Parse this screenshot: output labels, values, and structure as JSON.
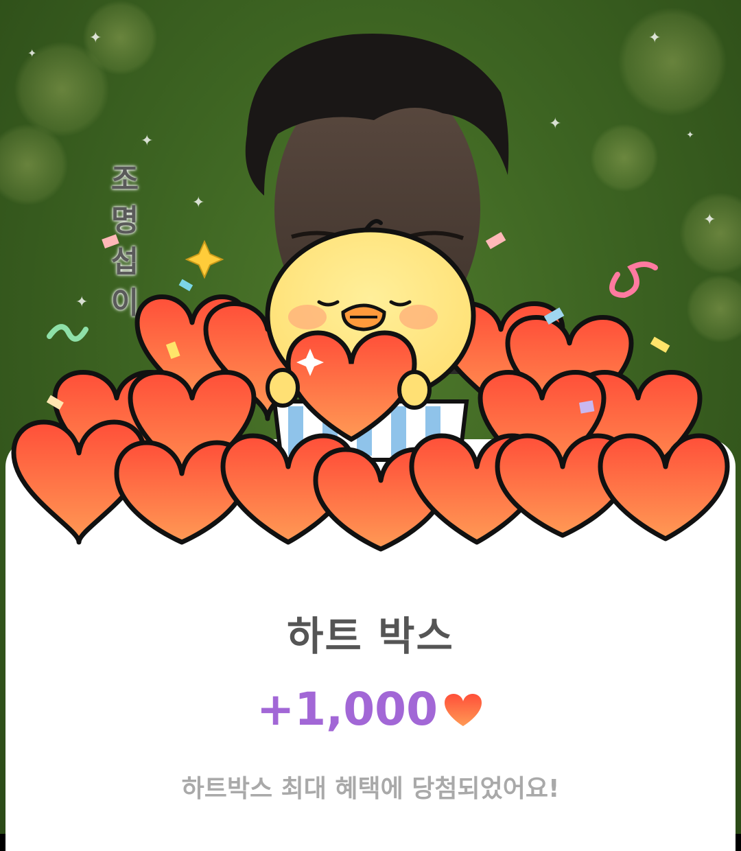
{
  "overlay": {
    "vertical_name": [
      "조",
      "명",
      "섭",
      "이"
    ]
  },
  "popup": {
    "title": "하트 박스",
    "reward_amount": "+1,000",
    "reward_icon": "heart-icon",
    "message": "하트박스 최대 혜택에 당첨되었어요!"
  },
  "colors": {
    "reward_text": "#a267d6",
    "title_text": "#555555",
    "message_text": "#a9a9a9",
    "heart_top": "#ff5a3c",
    "heart_bottom": "#ff9a55"
  }
}
